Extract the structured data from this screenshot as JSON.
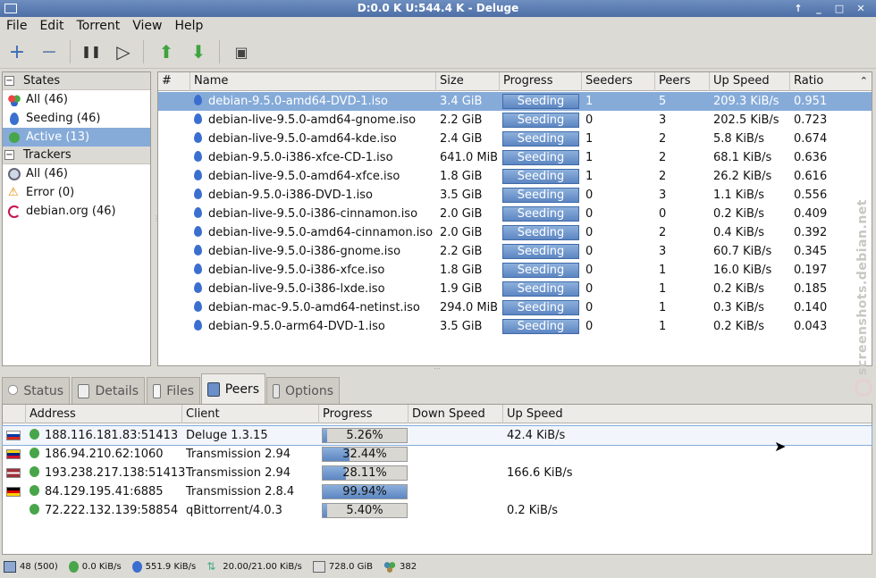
{
  "window": {
    "title": "D:0.0 K U:544.4 K - Deluge"
  },
  "menu": [
    "File",
    "Edit",
    "Torrent",
    "View",
    "Help"
  ],
  "toolbar": {
    "add": "+",
    "remove": "−",
    "pause": "❚❚",
    "resume": "▷",
    "queue_up": "⬆",
    "queue_down": "⬇",
    "preferences": "▣"
  },
  "sidebar": {
    "states_header": "States",
    "states": [
      {
        "label": "All (46)",
        "icon": "all-states-icon"
      },
      {
        "label": "Seeding (46)",
        "icon": "seeding-icon"
      },
      {
        "label": "Active (13)",
        "icon": "active-icon",
        "selected": true
      }
    ],
    "trackers_header": "Trackers",
    "trackers": [
      {
        "label": "All (46)",
        "icon": "globe-icon"
      },
      {
        "label": "Error (0)",
        "icon": "warning-icon"
      },
      {
        "label": "debian.org (46)",
        "icon": "debian-swirl-icon"
      }
    ]
  },
  "torrents": {
    "columns": [
      "#",
      "Name",
      "Size",
      "Progress",
      "Seeders",
      "Peers",
      "Up Speed",
      "Ratio"
    ],
    "rows": [
      {
        "name": "debian-9.5.0-amd64-DVD-1.iso",
        "size": "3.4 GiB",
        "progress": "Seeding",
        "seeders": "1",
        "peers": "5",
        "up": "209.3 KiB/s",
        "ratio": "0.951"
      },
      {
        "name": "debian-live-9.5.0-amd64-gnome.iso",
        "size": "2.2 GiB",
        "progress": "Seeding",
        "seeders": "0",
        "peers": "3",
        "up": "202.5 KiB/s",
        "ratio": "0.723"
      },
      {
        "name": "debian-live-9.5.0-amd64-kde.iso",
        "size": "2.4 GiB",
        "progress": "Seeding",
        "seeders": "1",
        "peers": "2",
        "up": "5.8 KiB/s",
        "ratio": "0.674"
      },
      {
        "name": "debian-9.5.0-i386-xfce-CD-1.iso",
        "size": "641.0 MiB",
        "progress": "Seeding",
        "seeders": "1",
        "peers": "2",
        "up": "68.1 KiB/s",
        "ratio": "0.636"
      },
      {
        "name": "debian-live-9.5.0-amd64-xfce.iso",
        "size": "1.8 GiB",
        "progress": "Seeding",
        "seeders": "1",
        "peers": "2",
        "up": "26.2 KiB/s",
        "ratio": "0.616"
      },
      {
        "name": "debian-9.5.0-i386-DVD-1.iso",
        "size": "3.5 GiB",
        "progress": "Seeding",
        "seeders": "0",
        "peers": "3",
        "up": "1.1 KiB/s",
        "ratio": "0.556"
      },
      {
        "name": "debian-live-9.5.0-i386-cinnamon.iso",
        "size": "2.0 GiB",
        "progress": "Seeding",
        "seeders": "0",
        "peers": "0",
        "up": "0.2 KiB/s",
        "ratio": "0.409"
      },
      {
        "name": "debian-live-9.5.0-amd64-cinnamon.iso",
        "size": "2.0 GiB",
        "progress": "Seeding",
        "seeders": "0",
        "peers": "2",
        "up": "0.4 KiB/s",
        "ratio": "0.392"
      },
      {
        "name": "debian-live-9.5.0-i386-gnome.iso",
        "size": "2.2 GiB",
        "progress": "Seeding",
        "seeders": "0",
        "peers": "3",
        "up": "60.7 KiB/s",
        "ratio": "0.345"
      },
      {
        "name": "debian-live-9.5.0-i386-xfce.iso",
        "size": "1.8 GiB",
        "progress": "Seeding",
        "seeders": "0",
        "peers": "1",
        "up": "16.0 KiB/s",
        "ratio": "0.197"
      },
      {
        "name": "debian-live-9.5.0-i386-lxde.iso",
        "size": "1.9 GiB",
        "progress": "Seeding",
        "seeders": "0",
        "peers": "1",
        "up": "0.2 KiB/s",
        "ratio": "0.185"
      },
      {
        "name": "debian-mac-9.5.0-amd64-netinst.iso",
        "size": "294.0 MiB",
        "progress": "Seeding",
        "seeders": "0",
        "peers": "1",
        "up": "0.3 KiB/s",
        "ratio": "0.140"
      },
      {
        "name": "debian-9.5.0-arm64-DVD-1.iso",
        "size": "3.5 GiB",
        "progress": "Seeding",
        "seeders": "0",
        "peers": "1",
        "up": "0.2 KiB/s",
        "ratio": "0.043"
      }
    ]
  },
  "tabs": [
    "Status",
    "Details",
    "Files",
    "Peers",
    "Options"
  ],
  "peers": {
    "columns": [
      "Address",
      "Client",
      "Progress",
      "Down Speed",
      "Up Speed"
    ],
    "rows": [
      {
        "country": "ru",
        "address": "188.116.181.83:51413",
        "client": "Deluge 1.3.15",
        "progress": "5.26%",
        "fraction": 0.0526,
        "down": "",
        "up": "42.4 KiB/s"
      },
      {
        "country": "ve",
        "address": "186.94.210.62:1060",
        "client": "Transmission 2.94",
        "progress": "32.44%",
        "fraction": 0.3244,
        "down": "",
        "up": ""
      },
      {
        "country": "lv",
        "address": "193.238.217.138:51413",
        "client": "Transmission 2.94",
        "progress": "28.11%",
        "fraction": 0.2811,
        "down": "",
        "up": "166.6 KiB/s"
      },
      {
        "country": "de",
        "address": "84.129.195.41:6885",
        "client": "Transmission 2.8.4",
        "progress": "99.94%",
        "fraction": 0.9994,
        "down": "",
        "up": ""
      },
      {
        "country": "",
        "address": "72.222.132.139:58854",
        "client": "qBittorrent/4.0.3",
        "progress": "5.40%",
        "fraction": 0.054,
        "down": "",
        "up": "0.2 KiB/s"
      }
    ]
  },
  "statusbar": {
    "connections": "48 (500)",
    "down": "0.0 KiB/s",
    "up": "551.9 KiB/s",
    "protocol": "20.00/21.00 KiB/s",
    "disk": "728.0 GiB",
    "dht": "382"
  },
  "watermark": "screenshots.debian.net",
  "colors": {
    "selection": "#86abd9",
    "progress_fill": "#5d86c2",
    "title_bar": "#4d6fa6"
  }
}
